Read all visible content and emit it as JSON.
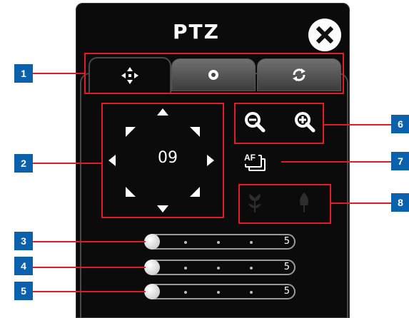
{
  "window": {
    "title": "PTZ"
  },
  "tabs": [
    {
      "id": "direction",
      "icon": "move-arrows-icon",
      "active": true
    },
    {
      "id": "preset",
      "icon": "record-dot-icon",
      "active": false
    },
    {
      "id": "cruise",
      "icon": "refresh-circle-icon",
      "active": false
    }
  ],
  "direction_pad": {
    "speed_value": "09"
  },
  "zoom": {
    "out_icon": "zoom-out-icon",
    "in_icon": "zoom-in-icon"
  },
  "autofocus": {
    "label": "AF"
  },
  "focus": {
    "near_icon": "flower-icon",
    "far_icon": "tree-icon"
  },
  "sliders": [
    {
      "value": "5"
    },
    {
      "value": "5"
    },
    {
      "value": "5"
    }
  ],
  "callouts": {
    "tabs": "1",
    "direction_pad": "2",
    "slider_1": "3",
    "slider_2": "4",
    "slider_3": "5",
    "zoom": "6",
    "autofocus": "7",
    "focus": "8"
  },
  "colors": {
    "callout_box": "#e41b23",
    "callout_badge": "#0c61ad",
    "panel": "#0b0b0b"
  }
}
